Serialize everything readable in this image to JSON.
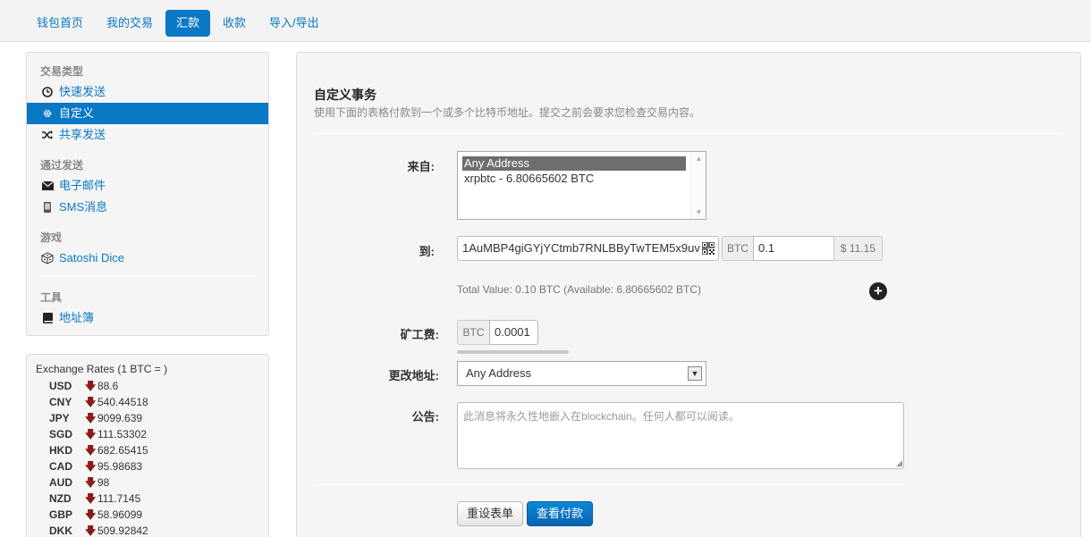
{
  "topnav": {
    "tabs": [
      {
        "label": "钱包首页"
      },
      {
        "label": "我的交易"
      },
      {
        "label": "汇款"
      },
      {
        "label": "收款"
      },
      {
        "label": "导入/导出"
      }
    ]
  },
  "sidebar": {
    "sections": [
      {
        "header": "交易类型",
        "items": [
          {
            "label": "快速发送",
            "icon": "clock-icon"
          },
          {
            "label": "自定义",
            "icon": "gear-icon"
          },
          {
            "label": "共享发送",
            "icon": "shuffle-icon"
          }
        ]
      },
      {
        "header": "通过发送",
        "items": [
          {
            "label": "电子邮件",
            "icon": "envelope-icon"
          },
          {
            "label": "SMS消息",
            "icon": "phone-icon"
          }
        ]
      },
      {
        "header": "游戏",
        "items": [
          {
            "label": "Satoshi Dice",
            "icon": "dice-icon"
          }
        ]
      },
      {
        "header": "工具",
        "items": [
          {
            "label": "地址簿",
            "icon": "book-icon"
          }
        ]
      }
    ]
  },
  "rates": {
    "title": "Exchange Rates (1 BTC = )",
    "rows": [
      {
        "currency": "USD",
        "value": "88.6"
      },
      {
        "currency": "CNY",
        "value": "540.44518"
      },
      {
        "currency": "JPY",
        "value": "9099.639"
      },
      {
        "currency": "SGD",
        "value": "111.53302"
      },
      {
        "currency": "HKD",
        "value": "682.65415"
      },
      {
        "currency": "CAD",
        "value": "95.98683"
      },
      {
        "currency": "AUD",
        "value": "98"
      },
      {
        "currency": "NZD",
        "value": "111.7145"
      },
      {
        "currency": "GBP",
        "value": "58.96099"
      },
      {
        "currency": "DKK",
        "value": "509.92842"
      }
    ]
  },
  "form": {
    "title": "自定义事务",
    "subtitle": "使用下面的表格付款到一个或多个比特币地址。提交之前会要求您检查交易内容。",
    "from_label": "来自:",
    "from_options": [
      "Any Address",
      "xrpbtc - 6.80665602 BTC"
    ],
    "to_label": "到:",
    "to_address": "1AuMBP4giGYjYCtmb7RNLBByTwTEM5x9uv",
    "to_currency": "BTC",
    "to_amount": "0.1",
    "to_fiat": "$ 11.15",
    "total_text": "Total Value: 0.10 BTC (Available: 6.80665602 BTC)",
    "fee_label": "矿工费:",
    "fee_currency": "BTC",
    "fee_amount": "0.0001",
    "change_label": "更改地址:",
    "change_value": "Any Address",
    "note_label": "公告:",
    "note_placeholder": "此消息将永久性地嵌入在blockchain。任何人都可以阅读。",
    "reset_button": "重设表单",
    "review_button": "查看付款"
  }
}
